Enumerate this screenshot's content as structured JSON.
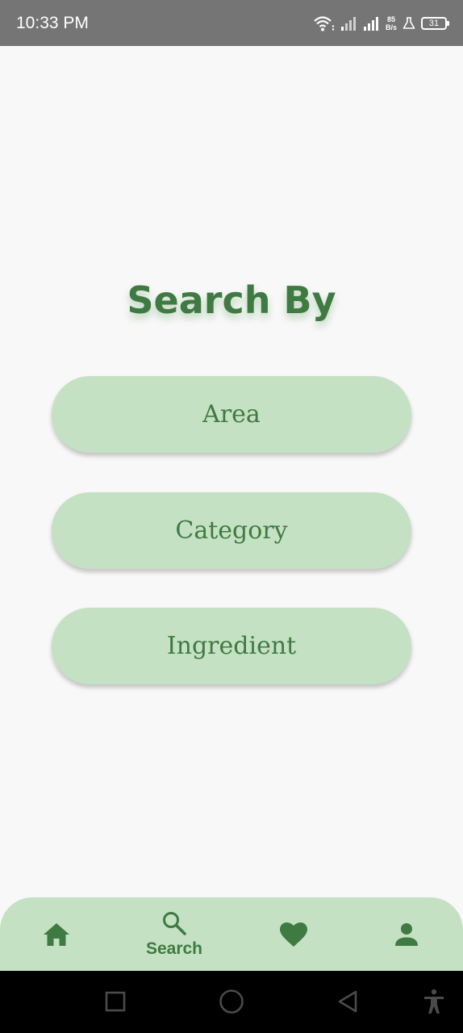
{
  "status_bar": {
    "time": "10:33 PM",
    "net_speed_value": "85",
    "net_speed_unit": "B/s",
    "battery_level": "31"
  },
  "main": {
    "title": "Search By",
    "options": [
      {
        "label": "Area"
      },
      {
        "label": "Category"
      },
      {
        "label": "Ingredient"
      }
    ]
  },
  "bottom_nav": {
    "items": [
      {
        "icon": "home-icon",
        "label": ""
      },
      {
        "icon": "search-icon",
        "label": "Search",
        "active": true
      },
      {
        "icon": "heart-icon",
        "label": ""
      },
      {
        "icon": "person-icon",
        "label": ""
      }
    ]
  },
  "colors": {
    "accent": "#3f7a42",
    "button_bg": "#c5e1c3",
    "background": "#f9f8f9",
    "status_bar": "#757575"
  }
}
